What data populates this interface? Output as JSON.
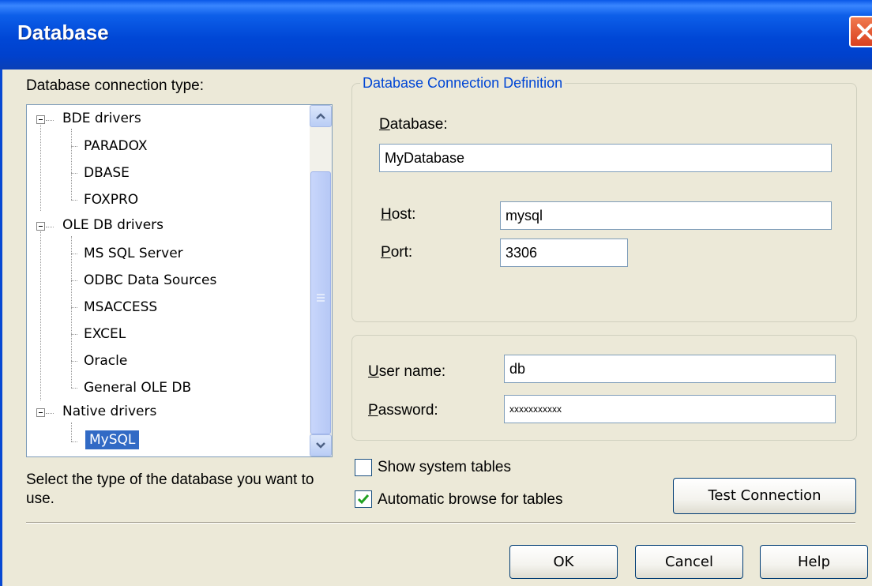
{
  "window": {
    "title": "Database",
    "close_icon": "close-icon"
  },
  "left": {
    "connection_label": "Database connection type:",
    "tree": {
      "groups": [
        {
          "label": "BDE drivers",
          "children": [
            "PARADOX",
            "DBASE",
            "FOXPRO"
          ]
        },
        {
          "label": "OLE DB drivers",
          "children": [
            "MS SQL Server",
            "ODBC Data Sources",
            "MSACCESS",
            "EXCEL",
            "Oracle",
            "General OLE DB"
          ]
        },
        {
          "label": "Native drivers",
          "children": [
            "MySQL"
          ]
        }
      ],
      "selected": "MySQL"
    },
    "hint": [
      "Select the type of the database you want to",
      "use."
    ]
  },
  "definition": {
    "legend": "Database Connection Definition",
    "database_label": "Database:",
    "database_value": "MyDatabase",
    "host_label": "Host:",
    "host_value": "mysql",
    "port_label": "Port:",
    "port_value": "3306"
  },
  "credentials": {
    "user_label": "User name:",
    "user_value": "db",
    "password_label": "Password:",
    "password_value": "xxxxxxxxxxx"
  },
  "options": {
    "show_system_tables": {
      "label": "Show system tables",
      "checked": false
    },
    "auto_browse": {
      "label": "Automatic browse for tables",
      "checked": true
    }
  },
  "buttons": {
    "test_connection": "Test Connection",
    "ok": "OK",
    "cancel": "Cancel",
    "help": "Help"
  },
  "colors": {
    "title_bar": "#0047d6",
    "legend": "#0046d5",
    "selection": "#316ac5",
    "check": "#21a121"
  }
}
